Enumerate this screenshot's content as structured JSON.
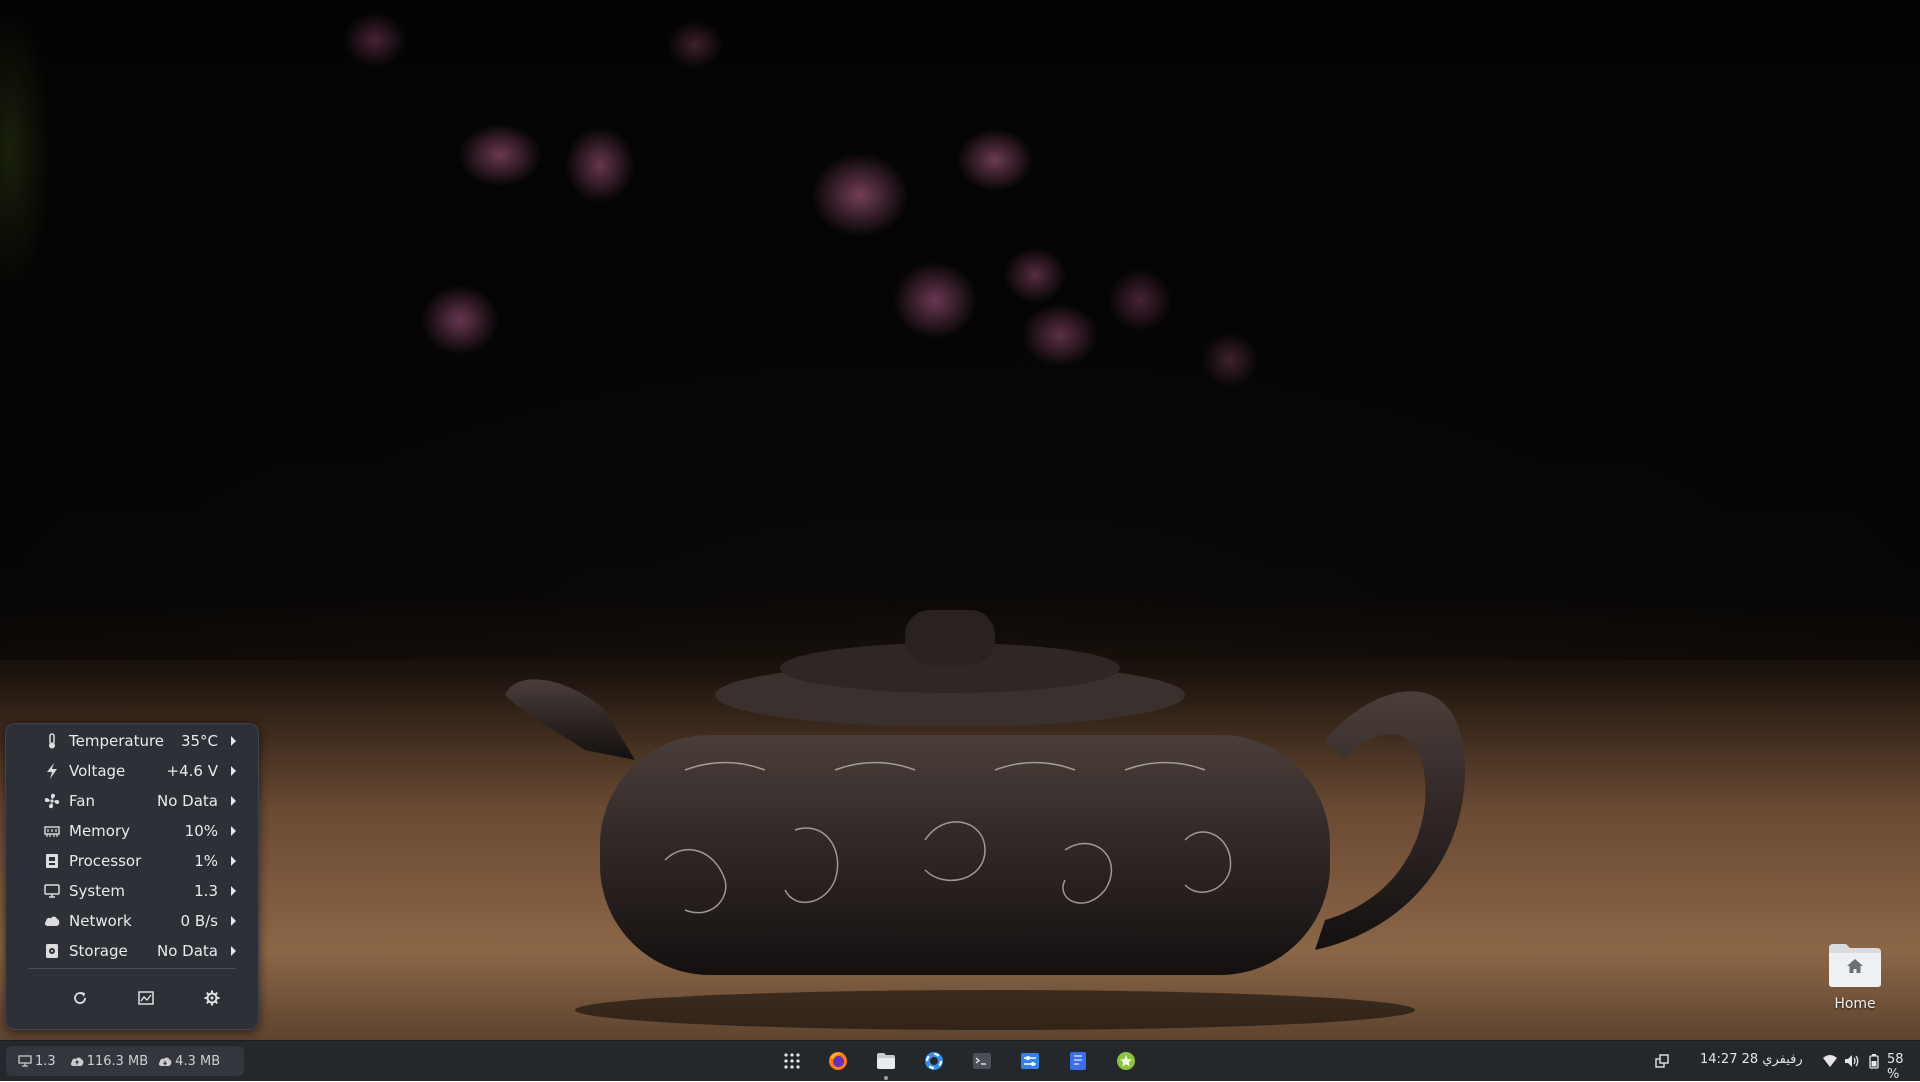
{
  "system_monitor": {
    "rows": [
      {
        "label": "Temperature",
        "value": "35°C",
        "icon": "thermometer-icon"
      },
      {
        "label": "Voltage",
        "value": "+4.6 V",
        "icon": "lightning-icon"
      },
      {
        "label": "Fan",
        "value": "No Data",
        "icon": "fan-icon"
      },
      {
        "label": "Memory",
        "value": "10%",
        "icon": "memory-icon"
      },
      {
        "label": "Processor",
        "value": "1%",
        "icon": "processor-icon"
      },
      {
        "label": "System",
        "value": "1.3",
        "icon": "monitor-icon"
      },
      {
        "label": "Network",
        "value": "0 B/s",
        "icon": "cloud-icon"
      },
      {
        "label": "Storage",
        "value": "No Data",
        "icon": "storage-icon"
      }
    ],
    "buttons": [
      "refresh-icon",
      "system-monitor-icon",
      "gear-icon"
    ]
  },
  "desktop": {
    "home_label": "Home"
  },
  "panel": {
    "stats": {
      "system_load": "1.3",
      "upload": "116.3 MB",
      "download": "4.3 MB"
    },
    "dock_items": [
      "app-grid-icon",
      "firefox-icon",
      "files-icon",
      "help-icon",
      "terminal-icon",
      "settings-icon",
      "text-editor-icon",
      "extension-icon"
    ],
    "clock": "14:27 28 رفيفري",
    "battery": "58 %",
    "accent": "#3584e4"
  }
}
